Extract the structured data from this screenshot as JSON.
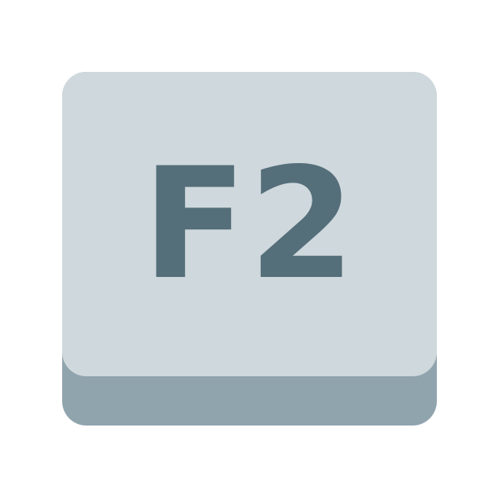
{
  "key": {
    "label": "F2"
  },
  "colors": {
    "background": "#ffffff",
    "key_top": "#cfd8dc",
    "key_side": "#90a4ae",
    "label": "#546e7a"
  },
  "icon": "f2-key-icon"
}
